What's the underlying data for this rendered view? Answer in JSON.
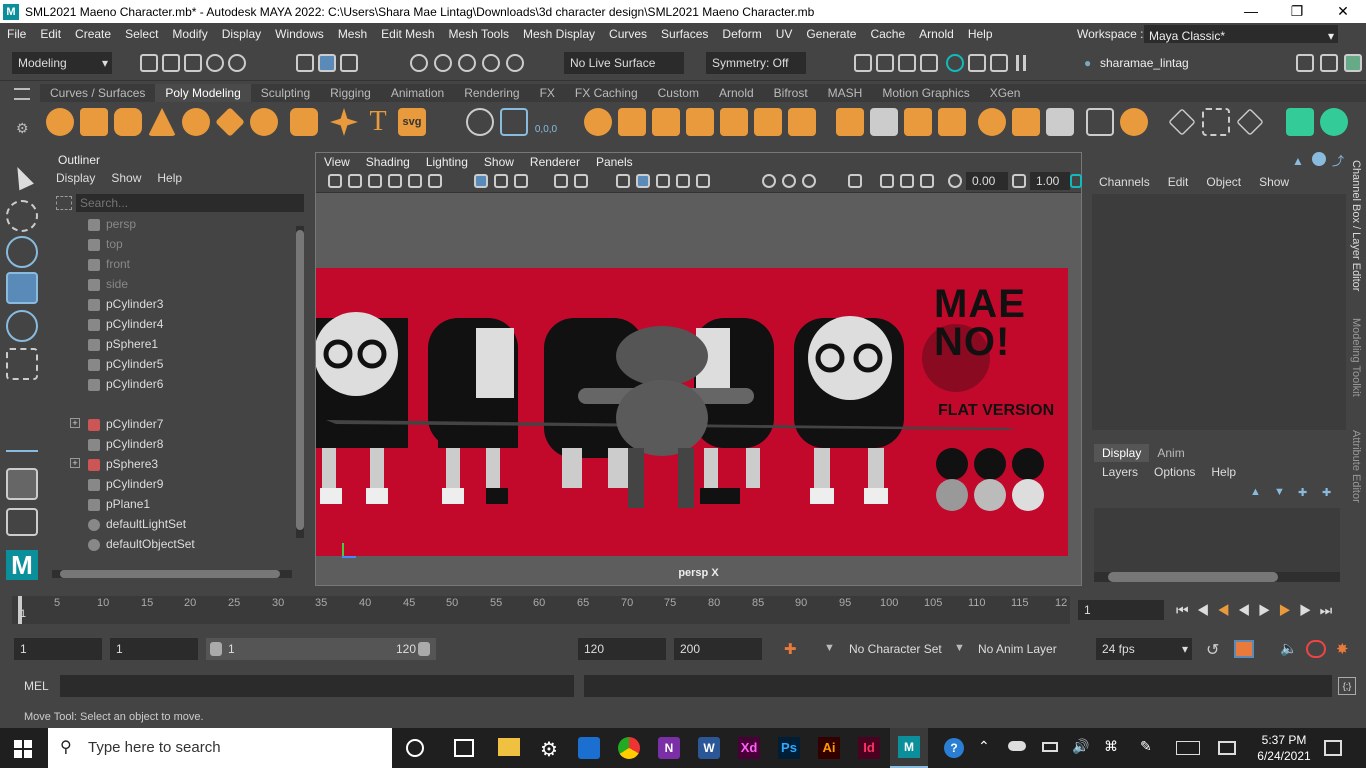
{
  "title": "SML2021 Maeno Character.mb* - Autodesk MAYA 2022: C:\\Users\\Shara Mae Lintag\\Downloads\\3d character design\\SML2021 Maeno Character.mb",
  "menus": [
    "File",
    "Edit",
    "Create",
    "Select",
    "Modify",
    "Display",
    "Windows",
    "Mesh",
    "Edit Mesh",
    "Mesh Tools",
    "Mesh Display",
    "Curves",
    "Surfaces",
    "Deform",
    "UV",
    "Generate",
    "Cache",
    "Arnold",
    "Help"
  ],
  "workspace_label": "Workspace :",
  "workspace_value": "Maya Classic*",
  "mode": "Modeling",
  "live_surface": "No Live Surface",
  "symmetry": "Symmetry: Off",
  "user": "sharamae_lintag",
  "shelf_tabs": [
    "Curves / Surfaces",
    "Poly Modeling",
    "Sculpting",
    "Rigging",
    "Animation",
    "Rendering",
    "FX",
    "FX Caching",
    "Custom",
    "Arnold",
    "Bifrost",
    "MASH",
    "Motion Graphics",
    "XGen"
  ],
  "shelf_labels": {
    "svg": "svg",
    "coords": "0,0,0"
  },
  "outliner": {
    "title": "Outliner",
    "menu": [
      "Display",
      "Show",
      "Help"
    ],
    "search_placeholder": "Search...",
    "items": [
      "persp",
      "top",
      "front",
      "side",
      "pCylinder3",
      "pCylinder4",
      "pSphere1",
      "pCylinder5",
      "pCylinder6",
      "pCylinder7",
      "pCylinder8",
      "pSphere3",
      "pCylinder9",
      "pPlane1",
      "defaultLightSet",
      "defaultObjectSet"
    ]
  },
  "viewport": {
    "menu": [
      "View",
      "Shading",
      "Lighting",
      "Show",
      "Renderer",
      "Panels"
    ],
    "value1": "0.00",
    "value2": "1.00",
    "camera_label": "persp X",
    "poster_text1": "MAE",
    "poster_text2": "NO!",
    "poster_text3": "FLAT VERSION"
  },
  "channelbox": {
    "menu": [
      "Channels",
      "Edit",
      "Object",
      "Show"
    ],
    "tabs": [
      "Display",
      "Anim"
    ],
    "layer_menu": [
      "Layers",
      "Options",
      "Help"
    ]
  },
  "side_tabs": [
    "Channel Box / Layer Editor",
    "Modeling Toolkit",
    "Attribute Editor"
  ],
  "timeline": {
    "ticks": [
      "1",
      "5",
      "10",
      "15",
      "20",
      "25",
      "30",
      "35",
      "40",
      "45",
      "50",
      "55",
      "60",
      "65",
      "70",
      "75",
      "80",
      "85",
      "90",
      "95",
      "100",
      "105",
      "110",
      "115",
      "12"
    ],
    "current_frame": "1"
  },
  "range": {
    "start": "1",
    "playback_start": "1",
    "slider_start": "1",
    "slider_end": "120",
    "playback_end": "120",
    "end": "200",
    "character_set": "No Character Set",
    "anim_layer": "No Anim Layer",
    "fps": "24 fps"
  },
  "cmd_label": "MEL",
  "help_text": "Move Tool: Select an object to move.",
  "taskbar": {
    "search_placeholder": "Type here to search",
    "time": "5:37 PM",
    "date": "6/24/2021",
    "apps": [
      "Xd",
      "Ps",
      "Ai",
      "Id"
    ]
  }
}
